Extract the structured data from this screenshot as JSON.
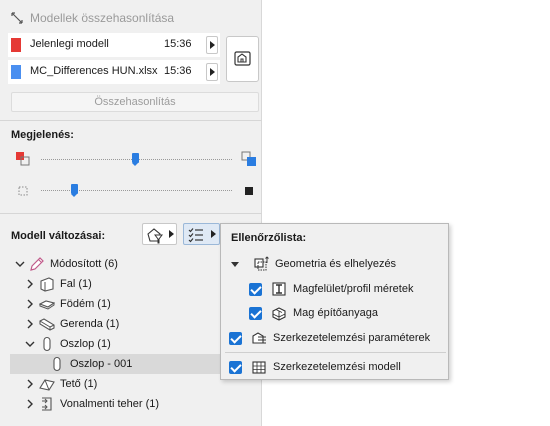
{
  "panel": {
    "title": "Modellek összehasonlítása",
    "files": [
      {
        "name": "Jelenlegi modell",
        "time": "15:36",
        "color": "#e53935"
      },
      {
        "name": "MC_Differences HUN.xlsx",
        "time": "15:36",
        "color": "#4a8ff0"
      }
    ],
    "compare_button": "Összehasonlítás",
    "appearance_label": "Megjelenés:",
    "changes_label": "Modell változásai:"
  },
  "tree": [
    {
      "label": "Módosított (6)",
      "icon": "pencil-icon",
      "level": 0,
      "expanded": true
    },
    {
      "label": "Fal (1)",
      "icon": "wall-icon",
      "level": 1,
      "expanded": false
    },
    {
      "label": "Födém (1)",
      "icon": "slab-icon",
      "level": 1,
      "expanded": false
    },
    {
      "label": "Gerenda (1)",
      "icon": "beam-icon",
      "level": 1,
      "expanded": false
    },
    {
      "label": "Oszlop (1)",
      "icon": "column-icon",
      "level": 1,
      "expanded": true
    },
    {
      "label": "Oszlop - 001",
      "icon": "column-icon",
      "level": 2,
      "selected": true
    },
    {
      "label": "Tető (1)",
      "icon": "roof-icon",
      "level": 1,
      "expanded": false
    },
    {
      "label": "Vonalmenti teher (1)",
      "icon": "line-load-icon",
      "level": 1,
      "expanded": false
    }
  ],
  "checklist": {
    "title": "Ellenőrzőlista:",
    "items": [
      {
        "label": "Geometria és elhelyezés",
        "icon": "geometry-icon",
        "type": "group"
      },
      {
        "label": "Magfelület/profil méretek",
        "icon": "profile-icon",
        "checked": true
      },
      {
        "label": "Mag építőanyaga",
        "icon": "material-icon",
        "checked": true
      },
      {
        "label": "Szerkezetelemzési paraméterek",
        "icon": "structural-params-icon",
        "checked": true
      },
      {
        "label": "Szerkezetelemzési modell",
        "icon": "structural-model-icon",
        "checked": true
      }
    ]
  },
  "colors": {
    "accent": "#1a73d4",
    "selection": "#d9d9d9",
    "panel_bg": "#f0f0f0"
  }
}
